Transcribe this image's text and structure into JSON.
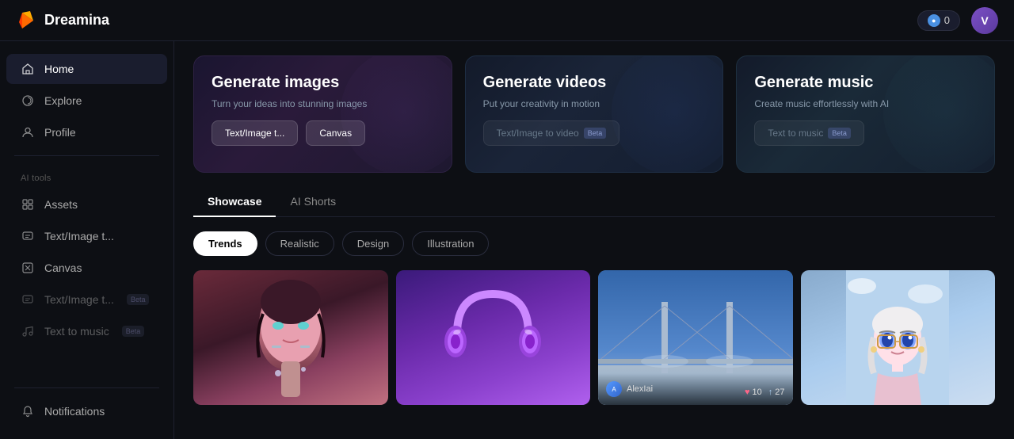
{
  "header": {
    "logo_text": "Dreamina",
    "credits": "0",
    "avatar_letter": "V"
  },
  "sidebar": {
    "tools_label": "AI tools",
    "items": [
      {
        "id": "home",
        "label": "Home",
        "active": true
      },
      {
        "id": "explore",
        "label": "Explore",
        "active": false
      },
      {
        "id": "profile",
        "label": "Profile",
        "active": false
      }
    ],
    "tool_items": [
      {
        "id": "assets",
        "label": "Assets",
        "beta": false
      },
      {
        "id": "textimage",
        "label": "Text/Image t...",
        "beta": false
      },
      {
        "id": "canvas",
        "label": "Canvas",
        "beta": false
      },
      {
        "id": "textimage2",
        "label": "Text/Image t...",
        "beta": true
      },
      {
        "id": "texttomusic",
        "label": "Text to music",
        "beta": true
      }
    ],
    "notifications_label": "Notifications"
  },
  "feature_cards": [
    {
      "id": "images",
      "title": "Generate images",
      "description": "Turn your ideas into stunning images",
      "btn1_label": "Text/Image t...",
      "btn2_label": "Canvas",
      "btn1_disabled": false,
      "btn2_disabled": false
    },
    {
      "id": "videos",
      "title": "Generate videos",
      "description": "Put your creativity in motion",
      "btn1_label": "Text/Image to video",
      "btn1_beta": "Beta",
      "btn1_disabled": true
    },
    {
      "id": "music",
      "title": "Generate music",
      "description": "Create music effortlessly with AI",
      "btn1_label": "Text to music",
      "btn1_beta": "Beta",
      "btn1_disabled": true
    }
  ],
  "tabs": [
    {
      "id": "showcase",
      "label": "Showcase",
      "active": true
    },
    {
      "id": "aishorts",
      "label": "AI Shorts",
      "active": false
    }
  ],
  "filters": [
    {
      "id": "trends",
      "label": "Trends",
      "active": true
    },
    {
      "id": "realistic",
      "label": "Realistic",
      "active": false
    },
    {
      "id": "design",
      "label": "Design",
      "active": false
    },
    {
      "id": "illustration",
      "label": "Illustration",
      "active": false
    }
  ],
  "gallery": [
    {
      "id": "cyborg-woman",
      "type": "cyborg-woman"
    },
    {
      "id": "headphones",
      "type": "headphones"
    },
    {
      "id": "bridge",
      "type": "bridge",
      "show_overlay": true,
      "user": "AlexIai",
      "likes": "10",
      "shares": "27"
    },
    {
      "id": "anime-girl",
      "type": "anime-girl"
    }
  ],
  "beta_label": "Beta",
  "icons": {
    "home": "⌂",
    "explore": "◎",
    "profile": "○",
    "assets": "◈",
    "textimage": "✦",
    "canvas": "⬡",
    "textimage2": "✦",
    "music": "♪",
    "notifications": "🔔",
    "coin": "●",
    "heart": "♥",
    "share": "↑"
  }
}
